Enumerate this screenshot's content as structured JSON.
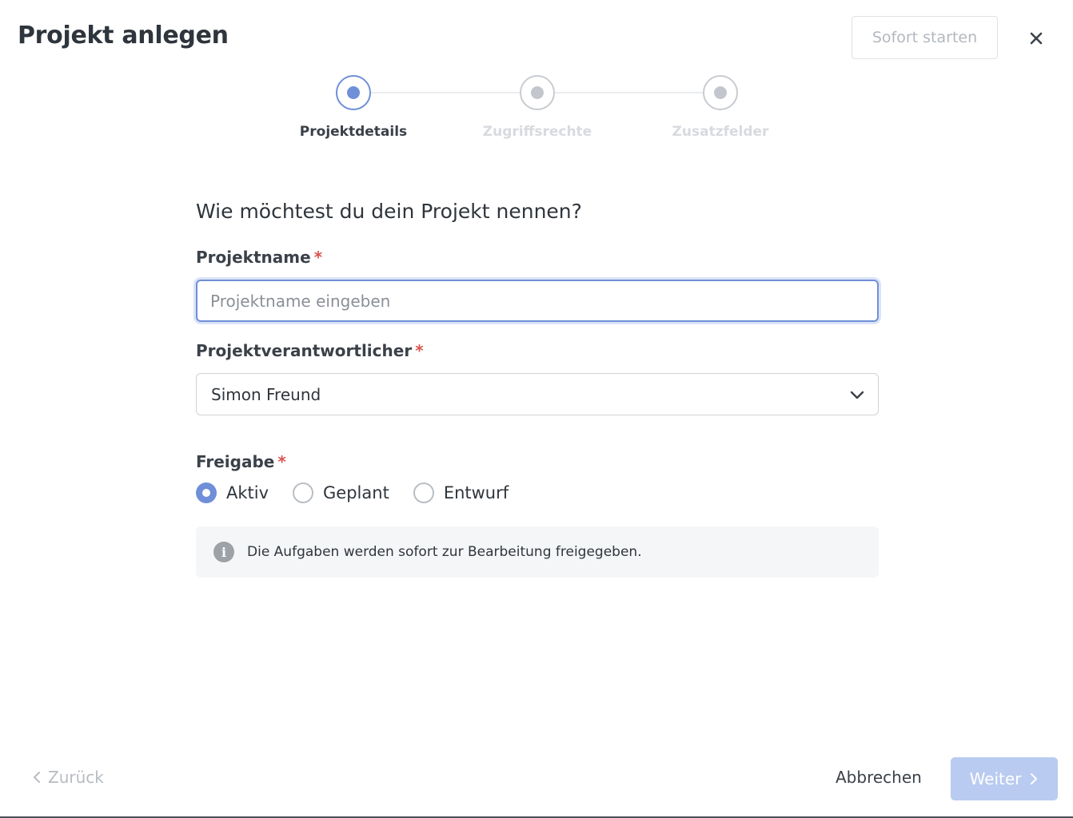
{
  "header": {
    "title": "Projekt anlegen",
    "start_button": "Sofort starten",
    "close_icon": "close-icon"
  },
  "stepper": {
    "steps": [
      {
        "label": "Projektdetails",
        "state": "active"
      },
      {
        "label": "Zugriffsrechte",
        "state": "inactive"
      },
      {
        "label": "Zusatzfelder",
        "state": "inactive"
      }
    ]
  },
  "form": {
    "question": "Wie möchtest du dein Projekt nennen?",
    "name_label": "Projektname",
    "name_placeholder": "Projektname eingeben",
    "name_value": "",
    "owner_label": "Projektverantwortlicher",
    "owner_value": "Simon Freund",
    "release_label": "Freigabe",
    "required_marker": "*",
    "release_options": [
      {
        "label": "Aktiv",
        "checked": true
      },
      {
        "label": "Geplant",
        "checked": false
      },
      {
        "label": "Entwurf",
        "checked": false
      }
    ],
    "info_text": "Die Aufgaben werden sofort zur Bearbeitung freigegeben."
  },
  "footer": {
    "back_label": "Zurück",
    "cancel_label": "Abbrechen",
    "next_label": "Weiter"
  },
  "colors": {
    "accent": "#6f8fd8",
    "required": "#d9534f",
    "next_button_disabled": "#b9cbf0"
  }
}
